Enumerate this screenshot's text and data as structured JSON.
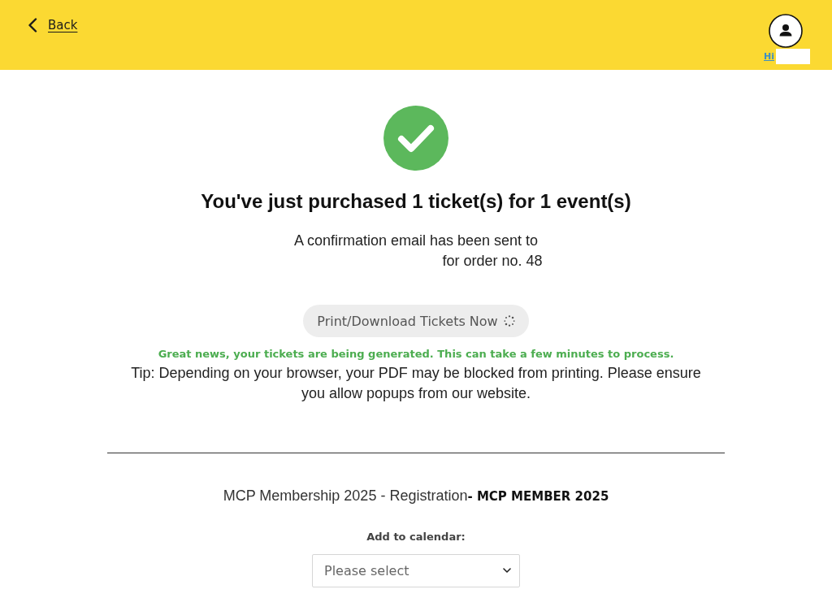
{
  "header": {
    "back_link": "Back",
    "greeting": "Hi"
  },
  "confirmation": {
    "heading": "You've just purchased 1 ticket(s) for 1 event(s)",
    "email_line": "A confirmation email has been sent to",
    "order_line": "for order no. 48"
  },
  "print_button": {
    "label": "Print/Download Tickets Now",
    "loading": true
  },
  "status_message": "Great news, your tickets are being generated. This can take a few minutes to process.",
  "tip": "Tip: Depending on your browser, your PDF may be blocked from printing. Please ensure you allow popups from our website.",
  "events": [
    {
      "title": "MCP Membership 2025 - Registration**- MCP MEMBER 2025**",
      "calendar_label": "Add to calendar:",
      "calendar_select": {
        "placeholder": "Please select"
      }
    }
  ]
}
